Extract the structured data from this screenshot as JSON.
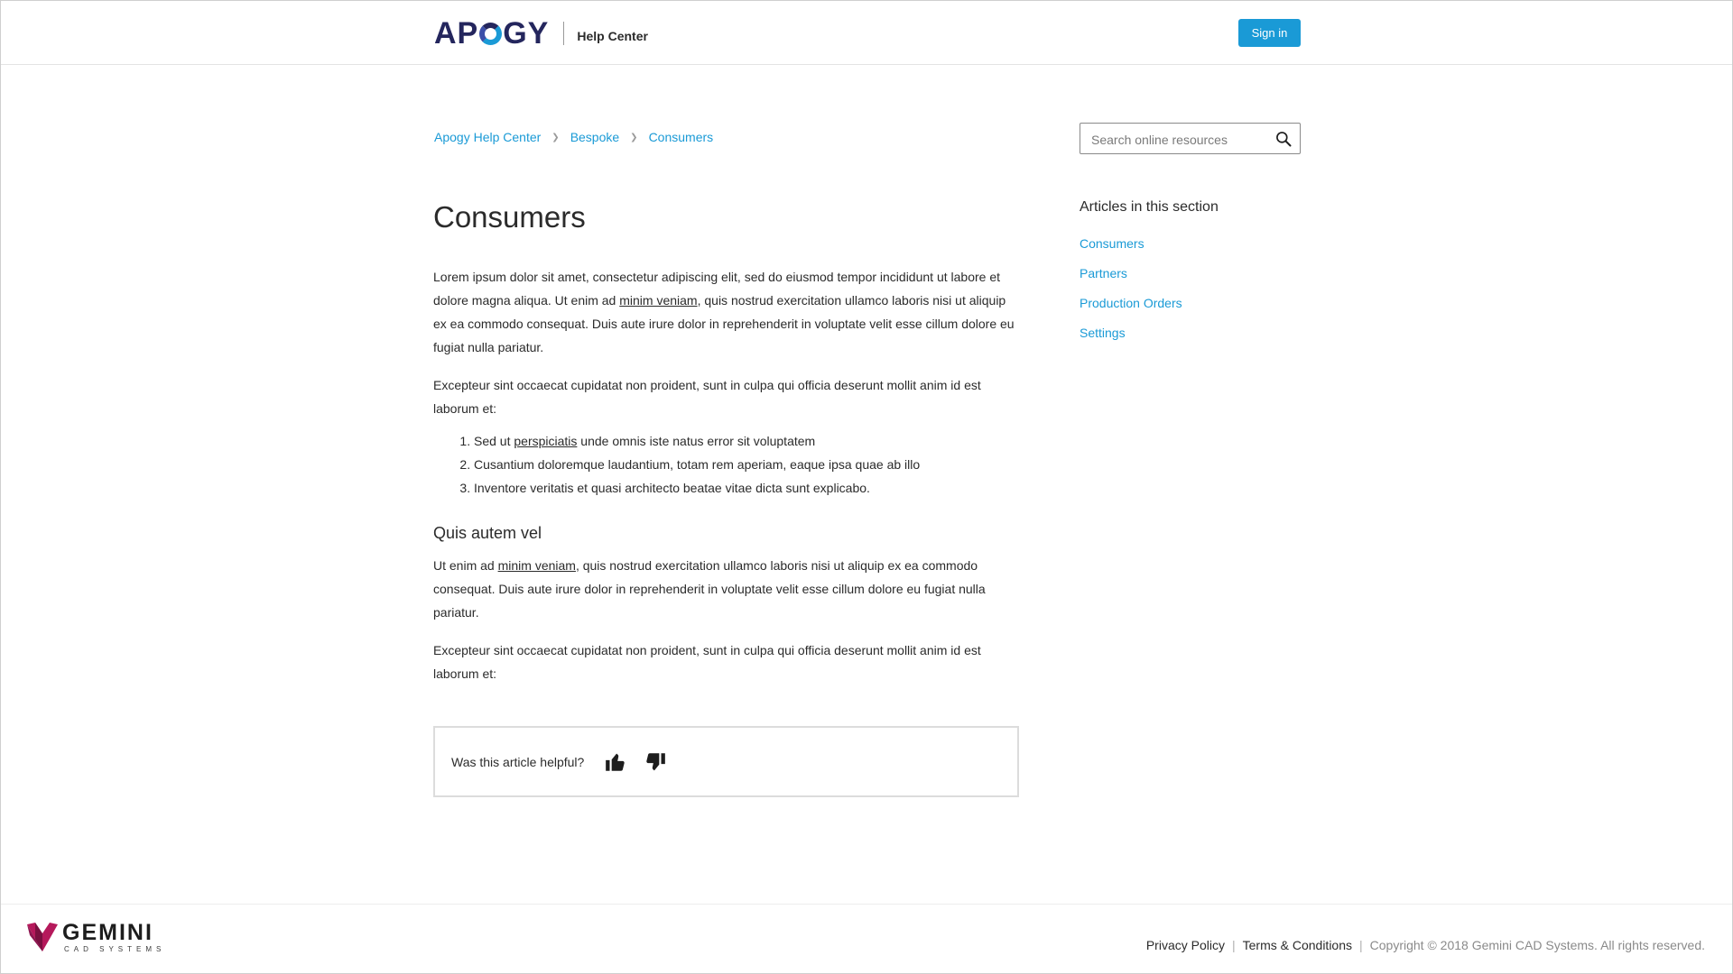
{
  "header": {
    "logo_text": "APOGY",
    "subtitle": "Help Center",
    "signin_label": "Sign in"
  },
  "breadcrumb": [
    {
      "label": "Apogy Help Center"
    },
    {
      "label": "Bespoke"
    },
    {
      "label": "Consumers"
    }
  ],
  "search": {
    "placeholder": "Search online resources",
    "value": ""
  },
  "article": {
    "title": "Consumers",
    "paragraph1_a": "Lorem ipsum dolor sit amet, consectetur adipiscing elit, sed do eiusmod tempor incididunt ut labore et dolore magna aliqua. Ut enim ad ",
    "paragraph1_link": "minim veniam",
    "paragraph1_b": ", quis nostrud exercitation ullamco laboris nisi ut aliquip ex ea commodo consequat. Duis aute irure dolor in reprehenderit in voluptate velit esse cillum dolore eu fugiat nulla pariatur.",
    "paragraph2": "Excepteur sint occaecat cupidatat non proident, sunt in culpa qui officia deserunt mollit anim id est laborum et:",
    "list": [
      {
        "a": "Sed ut ",
        "link": "perspiciatis",
        "b": " unde omnis iste natus error sit voluptatem"
      },
      {
        "text": "Cusantium doloremque laudantium, totam rem aperiam, eaque ipsa quae ab illo"
      },
      {
        "text": "Inventore veritatis et quasi architecto beatae vitae dicta sunt explicabo."
      }
    ],
    "subheading": "Quis autem vel",
    "paragraph3_a": "Ut enim ad ",
    "paragraph3_link": "minim veniam",
    "paragraph3_b": ", quis nostrud exercitation ullamco laboris nisi ut aliquip ex ea commodo consequat. Duis aute irure dolor in reprehenderit in voluptate velit esse cillum dolore eu fugiat nulla pariatur.",
    "paragraph4": "Excepteur sint occaecat cupidatat non proident, sunt in culpa qui officia deserunt mollit anim id est laborum et:",
    "feedback_question": "Was this article helpful?"
  },
  "sidebar": {
    "heading": "Articles in this section",
    "items": [
      {
        "label": "Consumers"
      },
      {
        "label": "Partners"
      },
      {
        "label": "Production Orders"
      },
      {
        "label": "Settings"
      }
    ]
  },
  "footer": {
    "logo_name": "GEMINI",
    "logo_sub": "CAD SYSTEMS",
    "privacy_label": "Privacy Policy",
    "terms_label": "Terms & Conditions",
    "copyright": "Copyright © 2018 Gemini CAD Systems. All rights reserved."
  },
  "colors": {
    "accent": "#1a9ad6",
    "brand_navy": "#24265d",
    "gemini_magenta": "#b5195b"
  },
  "icons": {
    "search": "search-icon",
    "thumbs_up": "thumbs-up-icon",
    "thumbs_down": "thumbs-down-icon",
    "breadcrumb_sep": "chevron-right-icon"
  }
}
